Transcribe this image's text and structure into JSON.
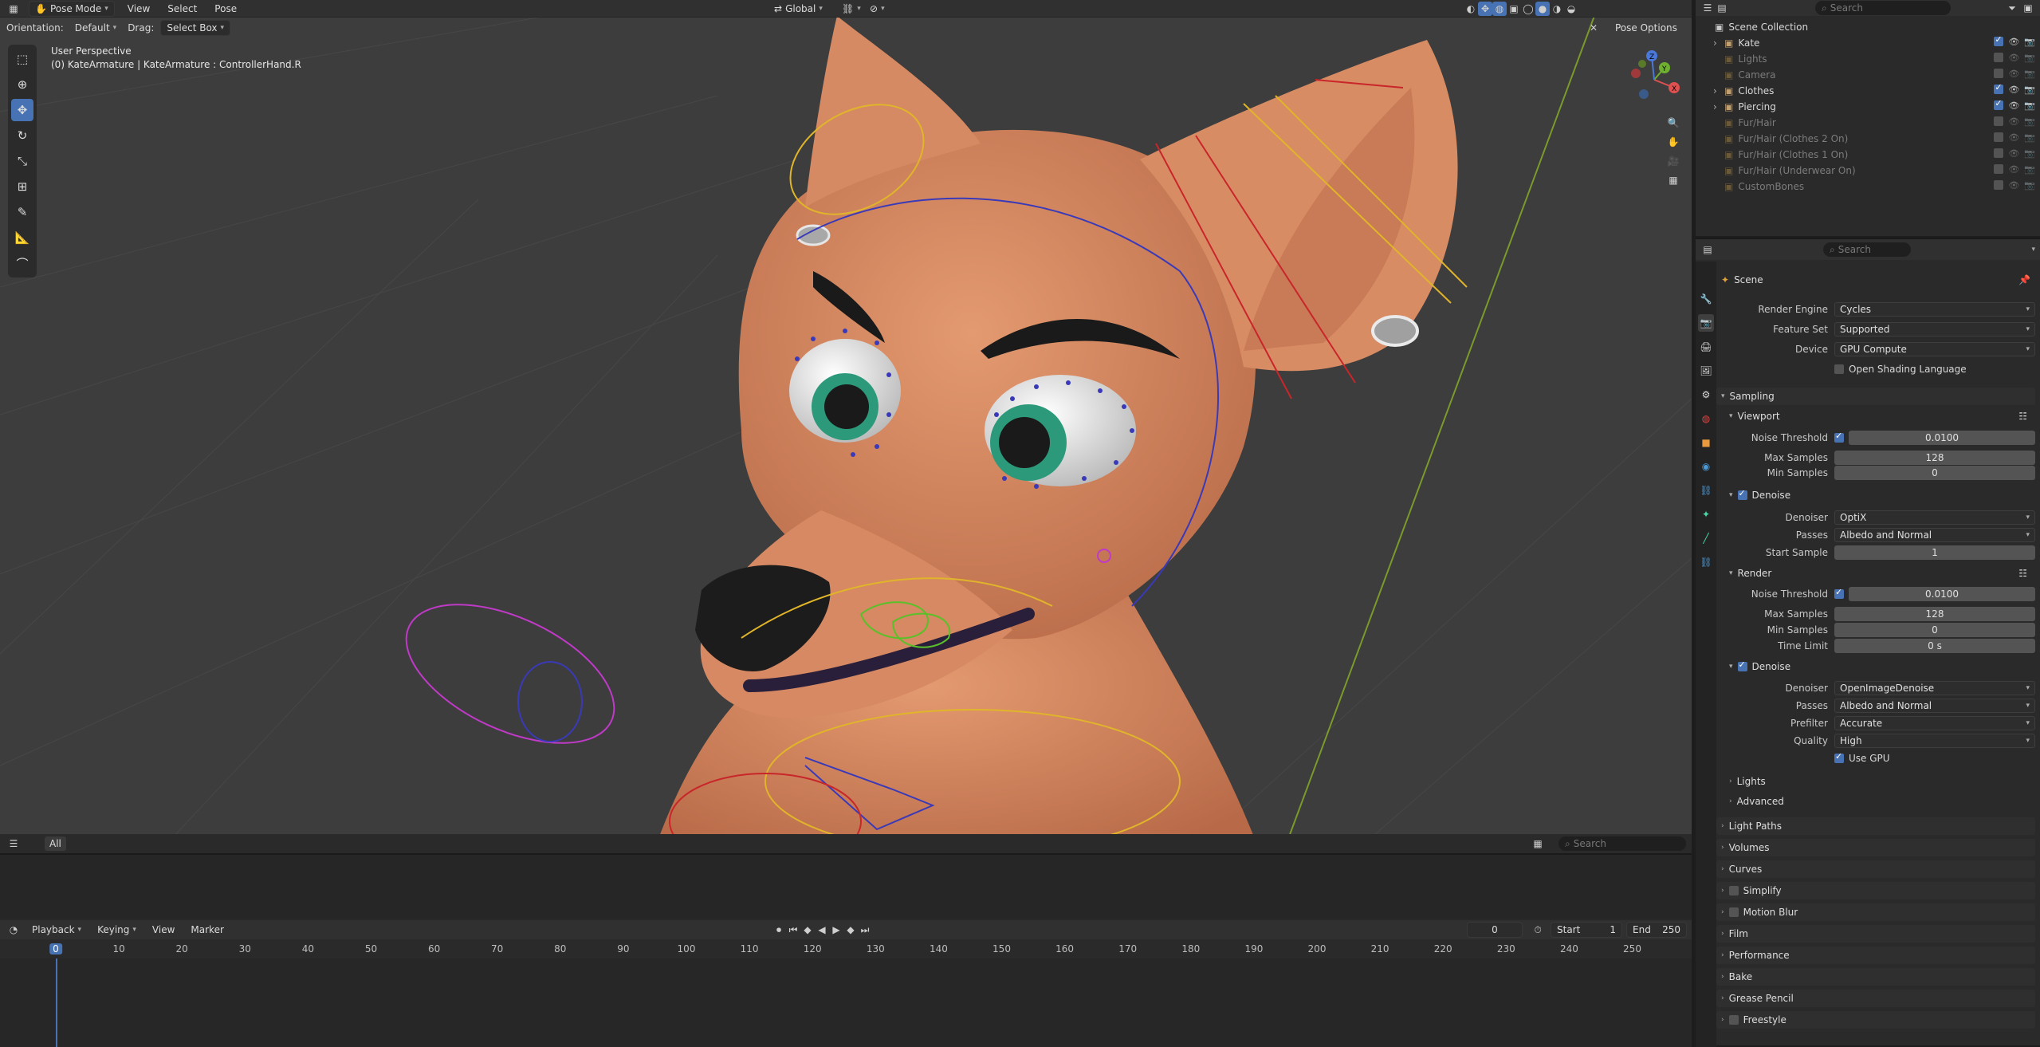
{
  "viewport": {
    "mode": "Pose Mode",
    "menus": [
      "View",
      "Select",
      "Pose"
    ],
    "transform_orientation": "Global",
    "orientation_label": "Orientation:",
    "orientation_value": "Default",
    "drag_label": "Drag:",
    "drag_value": "Select Box",
    "pose_options": "Pose Options",
    "top_search_placeholder": "Search",
    "perspective": "User Perspective",
    "active_object": "(0) KateArmature | KateArmature : ControllerHand.R",
    "footer_tab": "All",
    "footer_search_placeholder": "Search",
    "gizmo_axes": [
      "X",
      "Y",
      "Z"
    ]
  },
  "toolbar": [
    "select-box",
    "cursor",
    "move",
    "rotate",
    "scale",
    "transform",
    "annotate",
    "measure",
    "bone-size"
  ],
  "timeline": {
    "menus": [
      "Playback",
      "Keying",
      "View",
      "Marker"
    ],
    "current_frame": "0",
    "start_label": "Start",
    "start": "1",
    "end_label": "End",
    "end": "250",
    "ticks": [
      "0",
      "10",
      "20",
      "30",
      "40",
      "50",
      "60",
      "70",
      "80",
      "90",
      "100",
      "110",
      "120",
      "130",
      "140",
      "150",
      "160",
      "170",
      "180",
      "190",
      "200",
      "210",
      "220",
      "230",
      "240",
      "250"
    ]
  },
  "outliner": {
    "search_placeholder": "Search",
    "root": "Scene Collection",
    "items": [
      {
        "label": "Kate",
        "dim": false
      },
      {
        "label": "Lights",
        "dim": true
      },
      {
        "label": "Camera",
        "dim": true
      },
      {
        "label": "Clothes",
        "dim": false
      },
      {
        "label": "Piercing",
        "dim": false
      },
      {
        "label": "Fur/Hair",
        "dim": true
      },
      {
        "label": "Fur/Hair (Clothes 2 On)",
        "dim": true
      },
      {
        "label": "Fur/Hair (Clothes 1 On)",
        "dim": true
      },
      {
        "label": "Fur/Hair (Underwear On)",
        "dim": true
      },
      {
        "label": "CustomBones",
        "dim": true
      }
    ]
  },
  "properties": {
    "search_placeholder": "Search",
    "context": "Scene",
    "render_engine_label": "Render Engine",
    "render_engine": "Cycles",
    "feature_set_label": "Feature Set",
    "feature_set": "Supported",
    "device_label": "Device",
    "device": "GPU Compute",
    "osl_label": "Open Shading Language",
    "sampling": "Sampling",
    "viewport": "Viewport",
    "noise_threshold_label": "Noise Threshold",
    "vp_noise_threshold": "0.0100",
    "max_samples_label": "Max Samples",
    "vp_max_samples": "128",
    "min_samples_label": "Min Samples",
    "vp_min_samples": "0",
    "denoise_label": "Denoise",
    "denoiser_label": "Denoiser",
    "vp_denoiser": "OptiX",
    "passes_label": "Passes",
    "vp_passes": "Albedo and Normal",
    "start_sample_label": "Start Sample",
    "vp_start_sample": "1",
    "render": "Render",
    "r_noise_threshold": "0.0100",
    "r_max_samples": "128",
    "r_min_samples": "0",
    "time_limit_label": "Time Limit",
    "r_time_limit": "0 s",
    "r_denoiser": "OpenImageDenoise",
    "r_passes": "Albedo and Normal",
    "prefilter_label": "Prefilter",
    "r_prefilter": "Accurate",
    "quality_label": "Quality",
    "r_quality": "High",
    "use_gpu_label": "Use GPU",
    "lights": "Lights",
    "advanced": "Advanced",
    "panels": [
      "Light Paths",
      "Volumes",
      "Curves",
      "Simplify",
      "Motion Blur",
      "Film",
      "Performance",
      "Bake",
      "Grease Pencil",
      "Freestyle"
    ]
  },
  "colors": {
    "accent": "#4772b3",
    "skin": "#d88a63",
    "viewport_bg": "#3d3d3d"
  }
}
